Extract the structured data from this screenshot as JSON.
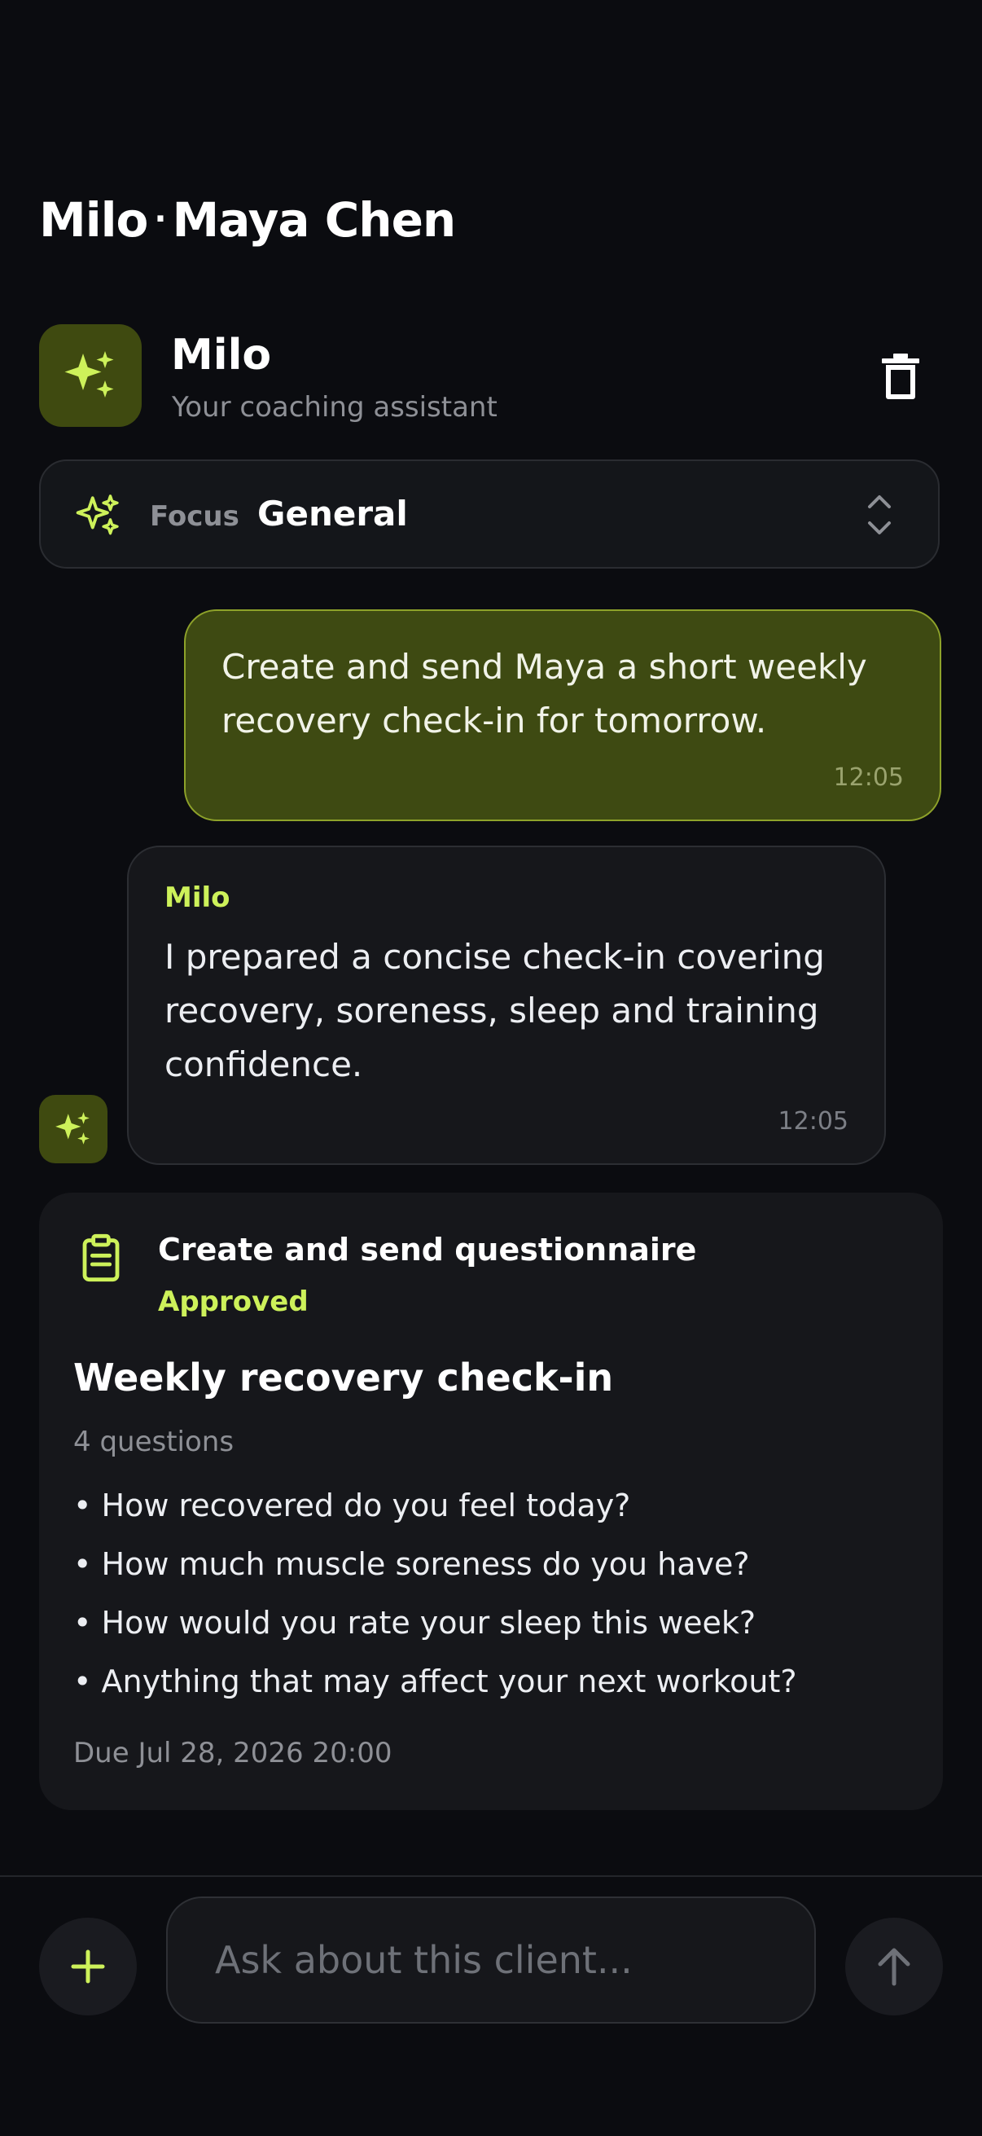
{
  "header": {
    "title_coach": "Milo",
    "title_separator": "·",
    "title_client": "Maya Chen"
  },
  "assistant": {
    "name": "Milo",
    "subtitle": "Your coaching assistant",
    "avatar_icon": "sparkles-icon",
    "delete_icon": "trash-icon"
  },
  "focus": {
    "label": "Focus",
    "value": "General",
    "icon": "sparkles-icon",
    "chevron_icon": "chevron-up-down-icon"
  },
  "messages": [
    {
      "role": "user",
      "text": "Create and send Maya a short weekly recovery check-in for tomorrow.",
      "time": "12:05"
    },
    {
      "role": "assistant",
      "sender": "Milo",
      "text": "I prepared a concise check-in covering recovery, soreness, sleep and training confidence.",
      "time": "12:05"
    }
  ],
  "action_card": {
    "icon": "clipboard-icon",
    "action": "Create and send questionnaire",
    "status": "Approved",
    "title": "Weekly recovery check-in",
    "count": "4 questions",
    "questions": [
      "• How recovered do you feel today?",
      "• How much muscle soreness do you have?",
      "• How would you rate your sleep this week?",
      "• Anything that may affect your next workout?"
    ],
    "due": "Due Jul 28, 2026 20:00"
  },
  "composer": {
    "placeholder": "Ask about this client...",
    "add_icon": "plus-icon",
    "send_icon": "arrow-up-icon"
  },
  "colors": {
    "background": "#0b0c10",
    "accent": "#cdf15a",
    "user_bubble": "#3e4a12",
    "card": "#16171b"
  }
}
